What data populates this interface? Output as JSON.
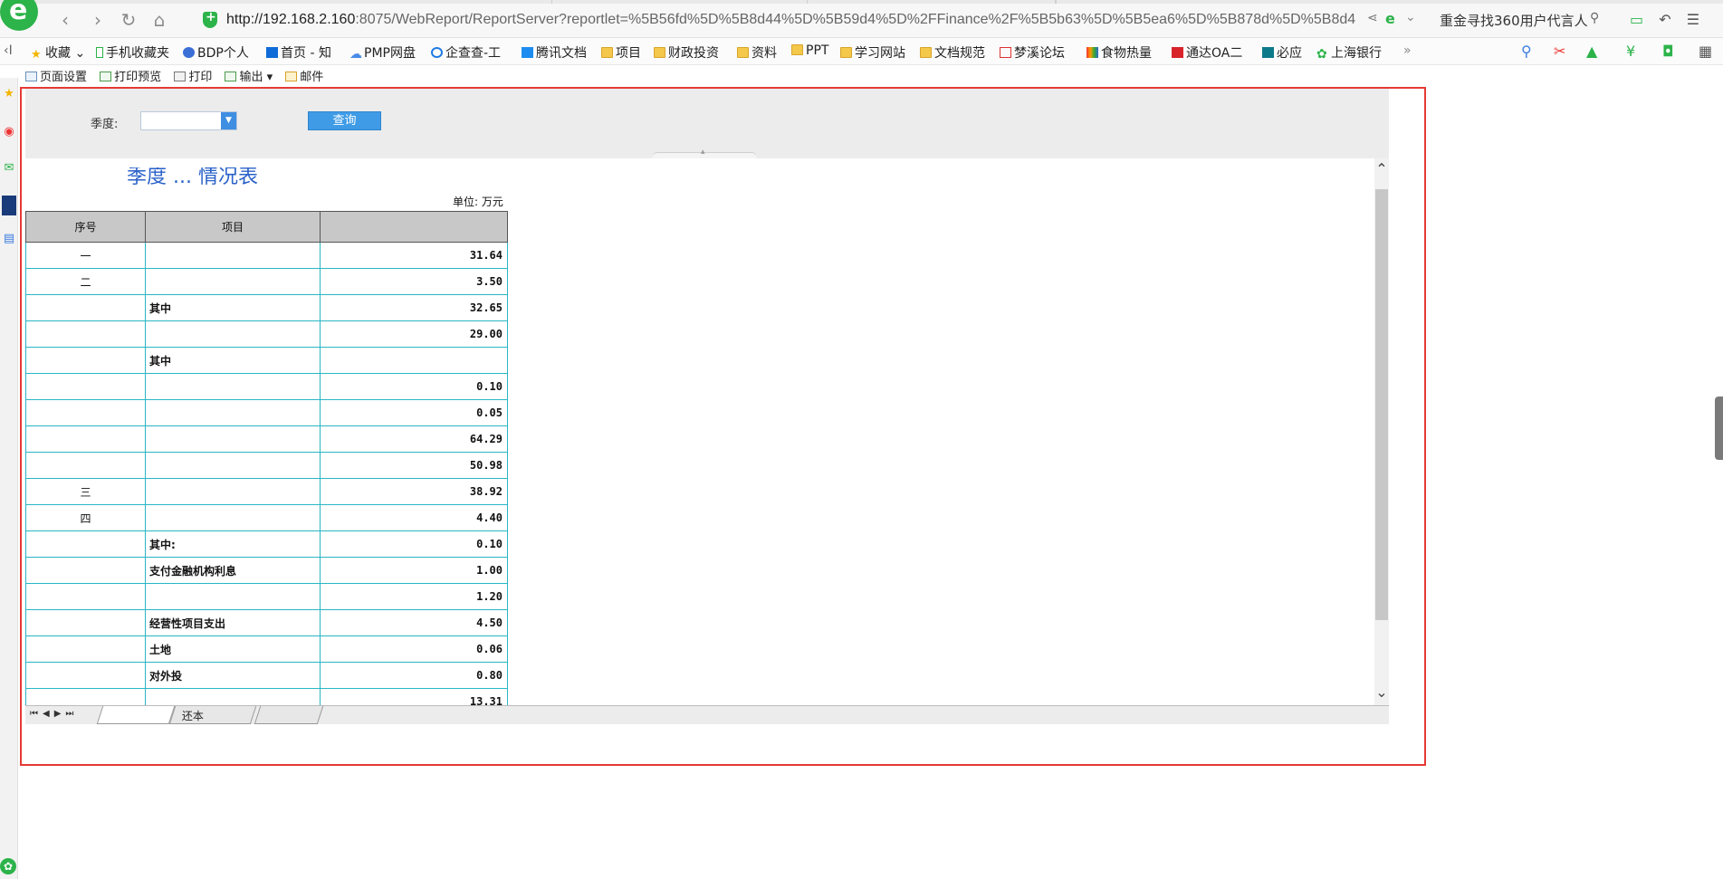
{
  "browser": {
    "url_host": "http://192.168.2.160",
    "url_rest": ":8075/WebReport/ReportServer?reportlet=%5B56fd%5D%5B8d44%5D%5B59d4%5D%2FFinance%2F%5B5b63%5D%5B5ea6%5D%5B878d%5D%5B8d4",
    "right_info": "重金寻找360用户代言人"
  },
  "bookmarks": [
    {
      "label": "收藏",
      "icon": "star-icon"
    },
    {
      "label": "手机收藏夹",
      "icon": "phone-icon"
    },
    {
      "label": "BDP个人",
      "icon": "bdp-icon"
    },
    {
      "label": "首页 - 知",
      "icon": "zhihu-icon"
    },
    {
      "label": "PMP网盘",
      "icon": "cloud-icon"
    },
    {
      "label": "企查查-工",
      "icon": "qichacha-icon"
    },
    {
      "label": "腾讯文档",
      "icon": "tencent-doc-icon"
    },
    {
      "label": "项目",
      "icon": "folder-icon"
    },
    {
      "label": "财政投资",
      "icon": "folder-icon"
    },
    {
      "label": "资料",
      "icon": "folder-icon"
    },
    {
      "label": "PPT",
      "icon": "folder-icon"
    },
    {
      "label": "学习网站",
      "icon": "folder-icon"
    },
    {
      "label": "文档规范",
      "icon": "folder-icon"
    },
    {
      "label": "梦溪论坛",
      "icon": "forum-icon"
    },
    {
      "label": "食物热量",
      "icon": "food-icon"
    },
    {
      "label": "通达OA二",
      "icon": "oa-icon"
    },
    {
      "label": "必应",
      "icon": "bing-icon"
    },
    {
      "label": "上海银行",
      "icon": "bank-icon"
    }
  ],
  "report_toolbar": {
    "page_setup": "页面设置",
    "print_preview": "打印预览",
    "print": "打印",
    "export": "输出",
    "mail": "邮件"
  },
  "params": {
    "quarter_label": "季度:",
    "quarter_value": "",
    "query_button": "查询"
  },
  "report": {
    "title": "季度 ... 情况表",
    "unit": "单位: 万元",
    "headers": [
      "序号",
      "项目",
      ""
    ],
    "rows": [
      {
        "no": "一",
        "item": "",
        "value": "31.64"
      },
      {
        "no": "二",
        "item": "",
        "value": "3.50"
      },
      {
        "no": "",
        "item": "其中",
        "value": "32.65"
      },
      {
        "no": "",
        "item": "",
        "value": "29.00"
      },
      {
        "no": "",
        "item": "其中",
        "value": ""
      },
      {
        "no": "",
        "item": "",
        "value": "0.10"
      },
      {
        "no": "",
        "item": "",
        "value": "0.05"
      },
      {
        "no": "",
        "item": "",
        "value": "64.29"
      },
      {
        "no": "",
        "item": "",
        "value": "50.98"
      },
      {
        "no": "三",
        "item": "",
        "value": "38.92"
      },
      {
        "no": "四",
        "item": "",
        "value": "4.40"
      },
      {
        "no": "",
        "item": "其中:",
        "value": "0.10"
      },
      {
        "no": "",
        "item": "支付金融机构利息",
        "value": "1.00"
      },
      {
        "no": "",
        "item": "",
        "value": "1.20"
      },
      {
        "no": "",
        "item": "经营性项目支出",
        "value": "4.50"
      },
      {
        "no": "",
        "item": "土地",
        "value": "0.06"
      },
      {
        "no": "",
        "item": "对外投",
        "value": "0.80"
      },
      {
        "no": "",
        "item": "",
        "value": "13.31"
      }
    ]
  },
  "sheet_tabs": [
    "",
    "还本",
    ""
  ],
  "colors": {
    "accent": "#3f9be6",
    "title": "#2a62c9",
    "grid": "#29b6c4",
    "frame": "#e53935"
  }
}
